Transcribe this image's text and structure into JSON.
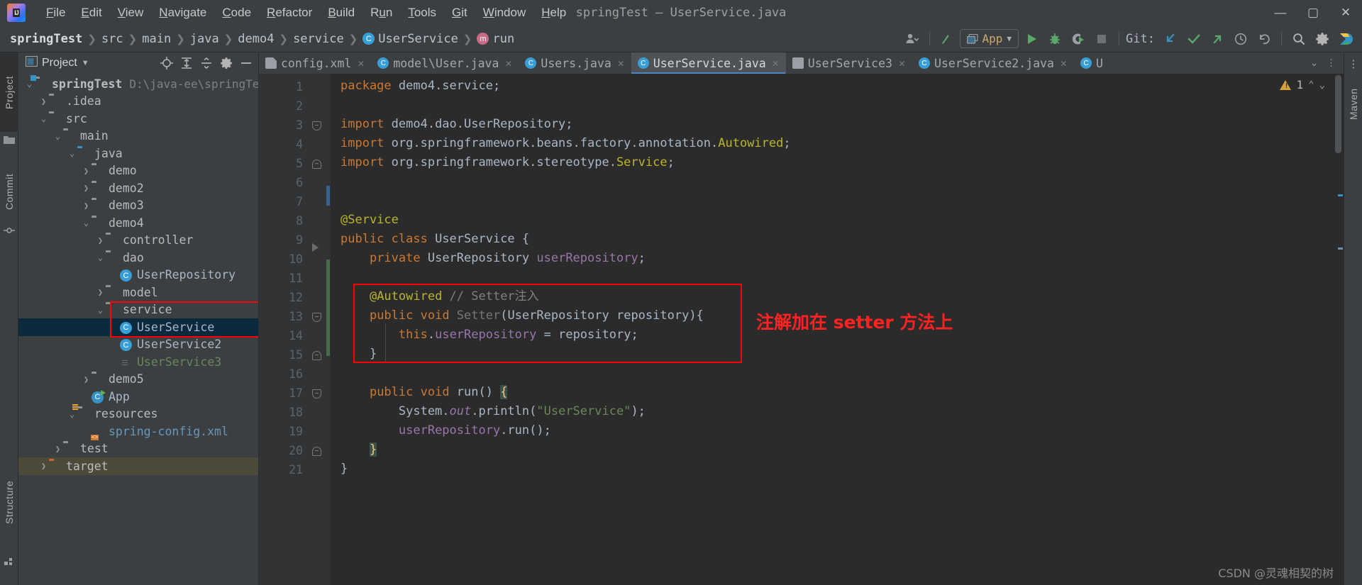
{
  "window": {
    "title": "springTest – UserService.java",
    "logo_text": "IJ",
    "controls": {
      "minimize": "—",
      "maximize": "▢",
      "close": "✕"
    }
  },
  "menubar": {
    "items": [
      {
        "label": "File",
        "accel": "F"
      },
      {
        "label": "Edit",
        "accel": "E"
      },
      {
        "label": "View",
        "accel": "V"
      },
      {
        "label": "Navigate",
        "accel": "N"
      },
      {
        "label": "Code",
        "accel": "C"
      },
      {
        "label": "Refactor",
        "accel": "R"
      },
      {
        "label": "Build",
        "accel": "B"
      },
      {
        "label": "Run",
        "accel": "u"
      },
      {
        "label": "Tools",
        "accel": "T"
      },
      {
        "label": "Git",
        "accel": "G"
      },
      {
        "label": "Window",
        "accel": "W"
      },
      {
        "label": "Help",
        "accel": "H"
      }
    ]
  },
  "breadcrumbs": [
    {
      "label": "springTest",
      "bold": true
    },
    {
      "label": "src"
    },
    {
      "label": "main"
    },
    {
      "label": "java"
    },
    {
      "label": "demo4"
    },
    {
      "label": "service"
    },
    {
      "label": "UserService",
      "badge": "C"
    },
    {
      "label": "run",
      "badge": "m"
    }
  ],
  "toolbar": {
    "run_config": "App",
    "git_label": "Git:",
    "icons": [
      "people-icon",
      "build-icon",
      "run-icon",
      "debug-icon",
      "run-coverage-icon",
      "stop-icon",
      "git-update-icon",
      "git-commit-icon",
      "git-push-icon",
      "history-icon",
      "rollback-icon",
      "search-icon",
      "settings-icon",
      "ide-help-icon"
    ]
  },
  "left_rail": {
    "labels": [
      "Project",
      "Commit",
      "Structure"
    ]
  },
  "right_rail": {
    "labels": [
      "Maven"
    ]
  },
  "project_panel": {
    "title": "Project",
    "header_icons": [
      "locate-icon",
      "expand-all-icon",
      "collapse-all-icon",
      "gear-icon",
      "hide-icon"
    ],
    "tree": [
      {
        "depth": 0,
        "arrow": "v",
        "icon": "module-folder",
        "label": "springTest",
        "bold": true,
        "path": "D:\\java-ee\\springTes"
      },
      {
        "depth": 1,
        "arrow": ">",
        "icon": "folder",
        "label": ".idea"
      },
      {
        "depth": 1,
        "arrow": "v",
        "icon": "folder",
        "label": "src"
      },
      {
        "depth": 2,
        "arrow": "v",
        "icon": "folder",
        "label": "main"
      },
      {
        "depth": 3,
        "arrow": "v",
        "icon": "folder-blue",
        "label": "java"
      },
      {
        "depth": 4,
        "arrow": ">",
        "icon": "package",
        "label": "demo"
      },
      {
        "depth": 4,
        "arrow": ">",
        "icon": "package",
        "label": "demo2"
      },
      {
        "depth": 4,
        "arrow": ">",
        "icon": "package",
        "label": "demo3"
      },
      {
        "depth": 4,
        "arrow": "v",
        "icon": "package",
        "label": "demo4"
      },
      {
        "depth": 5,
        "arrow": ">",
        "icon": "package",
        "label": "controller"
      },
      {
        "depth": 5,
        "arrow": "v",
        "icon": "package",
        "label": "dao"
      },
      {
        "depth": 6,
        "arrow": "",
        "icon": "class",
        "label": "UserRepository",
        "color": "cls"
      },
      {
        "depth": 5,
        "arrow": ">",
        "icon": "package",
        "label": "model"
      },
      {
        "depth": 5,
        "arrow": "v",
        "icon": "package",
        "label": "service",
        "outlined": true
      },
      {
        "depth": 6,
        "arrow": "",
        "icon": "class",
        "label": "UserService",
        "color": "cls",
        "selected": true
      },
      {
        "depth": 6,
        "arrow": "",
        "icon": "class",
        "label": "UserService2",
        "color": "cls"
      },
      {
        "depth": 6,
        "arrow": "",
        "icon": "file",
        "label": "UserService3",
        "color": "green"
      },
      {
        "depth": 4,
        "arrow": ">",
        "icon": "package",
        "label": "demo5"
      },
      {
        "depth": 4,
        "arrow": "",
        "icon": "class-run",
        "label": "App",
        "color": "cls"
      },
      {
        "depth": 3,
        "arrow": "v",
        "icon": "folder-resources",
        "label": "resources"
      },
      {
        "depth": 4,
        "arrow": "",
        "icon": "xml",
        "label": "spring-config.xml",
        "color": "blue"
      },
      {
        "depth": 2,
        "arrow": ">",
        "icon": "folder",
        "label": "test"
      },
      {
        "depth": 1,
        "arrow": ">",
        "icon": "folder-orange",
        "label": "target",
        "highlighted": true
      }
    ]
  },
  "editor": {
    "tabs": [
      {
        "label": "config.xml",
        "icon": "xml",
        "active": false,
        "closable": true
      },
      {
        "label": "model\\User.java",
        "icon": "class",
        "active": false,
        "closable": true
      },
      {
        "label": "Users.java",
        "icon": "class",
        "active": false,
        "closable": true
      },
      {
        "label": "UserService.java",
        "icon": "class",
        "active": true,
        "closable": true
      },
      {
        "label": "UserService3",
        "icon": "file",
        "active": false,
        "closable": true
      },
      {
        "label": "UserService2.java",
        "icon": "class",
        "active": false,
        "closable": true
      },
      {
        "label": "U",
        "icon": "class",
        "active": false,
        "closable": false
      }
    ],
    "tabs_overflow": "⌄",
    "tabs_menu": "⋮",
    "inspection": {
      "count": "1",
      "up": "⌃",
      "down": "⌄"
    },
    "line_numbers": [
      1,
      2,
      3,
      4,
      5,
      6,
      7,
      8,
      9,
      10,
      11,
      12,
      13,
      14,
      15,
      16,
      17,
      18,
      19,
      20,
      21
    ],
    "code_lines": [
      {
        "n": 1,
        "tokens": [
          {
            "t": "package ",
            "c": "kw"
          },
          {
            "t": "demo4.service;",
            "c": "plain"
          }
        ]
      },
      {
        "n": 2,
        "tokens": []
      },
      {
        "n": 3,
        "tokens": [
          {
            "t": "import ",
            "c": "kw"
          },
          {
            "t": "demo4.dao.UserRepository;",
            "c": "plain"
          }
        ]
      },
      {
        "n": 4,
        "tokens": [
          {
            "t": "import ",
            "c": "kw"
          },
          {
            "t": "org.springframework.beans.factory.annotation.",
            "c": "plain"
          },
          {
            "t": "Autowired",
            "c": "ann"
          },
          {
            "t": ";",
            "c": "plain"
          }
        ]
      },
      {
        "n": 5,
        "tokens": [
          {
            "t": "import ",
            "c": "kw"
          },
          {
            "t": "org.springframework.stereotype.",
            "c": "plain"
          },
          {
            "t": "Service",
            "c": "ann"
          },
          {
            "t": ";",
            "c": "plain"
          }
        ]
      },
      {
        "n": 6,
        "tokens": []
      },
      {
        "n": 7,
        "tokens": []
      },
      {
        "n": 8,
        "tokens": [
          {
            "t": "@Service",
            "c": "ann"
          }
        ]
      },
      {
        "n": 9,
        "tokens": [
          {
            "t": "public ",
            "c": "kw"
          },
          {
            "t": "class ",
            "c": "kw"
          },
          {
            "t": "UserService",
            "c": "cls-name"
          },
          {
            "t": " {",
            "c": "plain"
          }
        ]
      },
      {
        "n": 10,
        "tokens": [
          {
            "t": "    ",
            "c": "plain"
          },
          {
            "t": "private ",
            "c": "kw"
          },
          {
            "t": "UserRepository ",
            "c": "plain"
          },
          {
            "t": "userRepository",
            "c": "field"
          },
          {
            "t": ";",
            "c": "plain"
          }
        ]
      },
      {
        "n": 11,
        "tokens": []
      },
      {
        "n": 12,
        "tokens": [
          {
            "t": "    ",
            "c": "plain"
          },
          {
            "t": "@Autowired",
            "c": "ann"
          },
          {
            "t": " // Setter注入",
            "c": "cmt"
          }
        ]
      },
      {
        "n": 13,
        "tokens": [
          {
            "t": "    ",
            "c": "plain"
          },
          {
            "t": "public ",
            "c": "kw"
          },
          {
            "t": "void ",
            "c": "kw"
          },
          {
            "t": "Setter",
            "c": "grey"
          },
          {
            "t": "(UserRepository repository){",
            "c": "plain"
          }
        ]
      },
      {
        "n": 14,
        "tokens": [
          {
            "t": "        ",
            "c": "plain"
          },
          {
            "t": "this",
            "c": "kw"
          },
          {
            "t": ".",
            "c": "plain"
          },
          {
            "t": "userRepository",
            "c": "field"
          },
          {
            "t": " = repository;",
            "c": "plain"
          }
        ]
      },
      {
        "n": 15,
        "tokens": [
          {
            "t": "    }",
            "c": "plain"
          }
        ]
      },
      {
        "n": 16,
        "tokens": []
      },
      {
        "n": 17,
        "tokens": [
          {
            "t": "    ",
            "c": "plain"
          },
          {
            "t": "public ",
            "c": "kw"
          },
          {
            "t": "void ",
            "c": "kw"
          },
          {
            "t": "run",
            "c": "plain"
          },
          {
            "t": "() ",
            "c": "plain"
          },
          {
            "t": "{",
            "c": "brace"
          }
        ]
      },
      {
        "n": 18,
        "tokens": [
          {
            "t": "        System.",
            "c": "plain"
          },
          {
            "t": "out",
            "c": "field-italic"
          },
          {
            "t": ".println(",
            "c": "plain"
          },
          {
            "t": "\"UserService\"",
            "c": "str"
          },
          {
            "t": ");",
            "c": "plain"
          }
        ]
      },
      {
        "n": 19,
        "tokens": [
          {
            "t": "        ",
            "c": "plain"
          },
          {
            "t": "userRepository",
            "c": "field"
          },
          {
            "t": ".run();",
            "c": "plain"
          }
        ]
      },
      {
        "n": 20,
        "tokens": [
          {
            "t": "    ",
            "c": "plain"
          },
          {
            "t": "}",
            "c": "brace"
          }
        ]
      },
      {
        "n": 21,
        "tokens": [
          {
            "t": "}",
            "c": "plain"
          }
        ]
      }
    ],
    "annotation": {
      "text": "注解加在 setter 方法上",
      "color": "#ff2222",
      "box_color": "#ff0000"
    }
  },
  "watermark": "CSDN @灵魂相契的树",
  "colors": {
    "accent_blue": "#3592c4",
    "editor_bg": "#2b2b2b",
    "panel_bg": "#3c3f41",
    "gutter_bg": "#313335",
    "selection": "#0d293e",
    "keyword": "#cc7832",
    "annotation": "#bbb529",
    "string": "#6a8759",
    "field": "#9876aa",
    "comment": "#808080"
  }
}
